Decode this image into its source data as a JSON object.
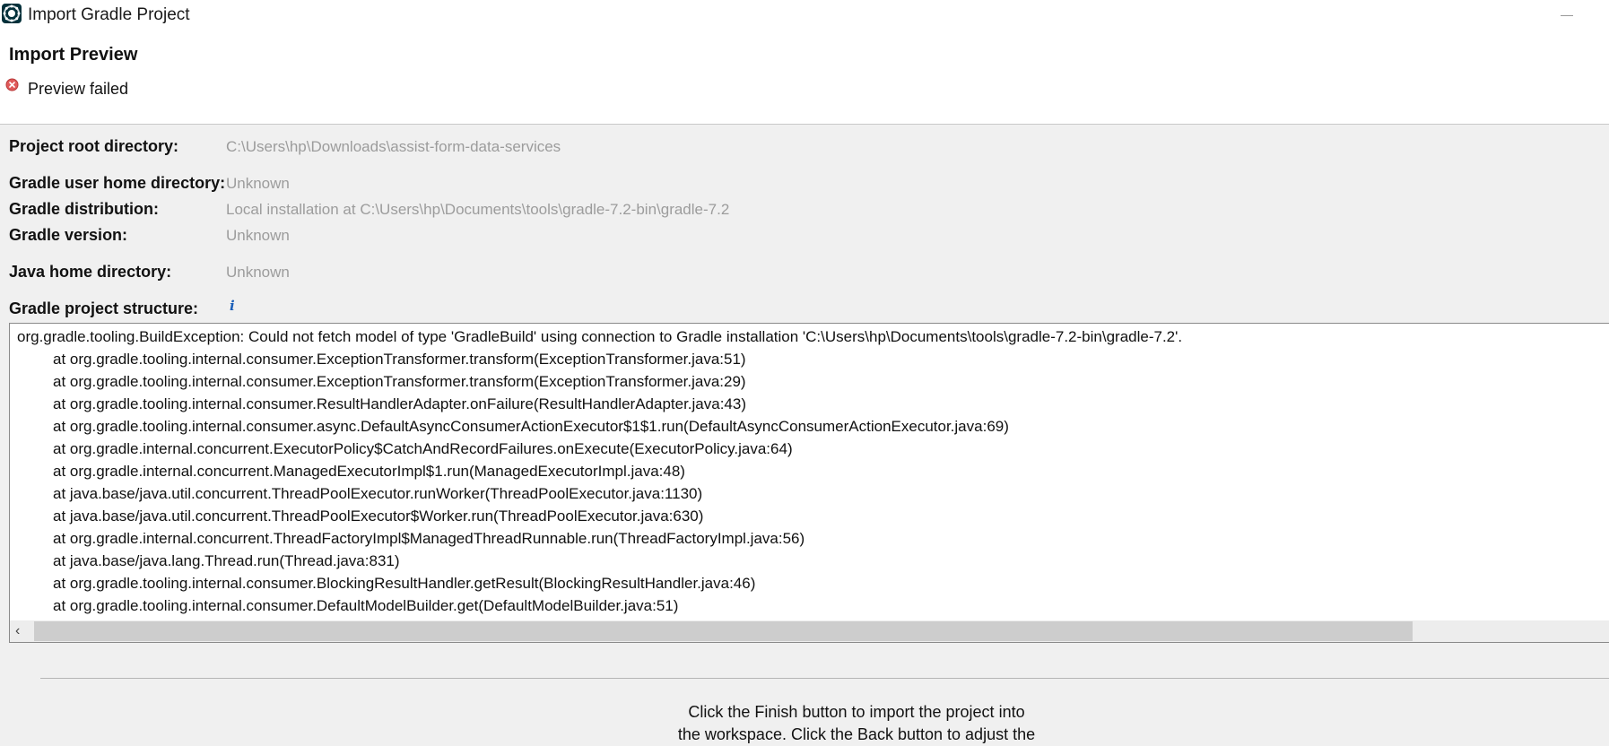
{
  "window": {
    "title": "Import Gradle Project",
    "icon": "gradle-eclipse-icon"
  },
  "header": {
    "title": "Import Preview",
    "status_icon": "error-icon",
    "status": "Preview failed"
  },
  "properties": [
    {
      "label": "Project root directory:",
      "value": "C:\\Users\\hp\\Downloads\\assist-form-data-services"
    },
    {
      "label": "Gradle user home directory:",
      "value": "Unknown"
    },
    {
      "label": "Gradle distribution:",
      "value": "Local installation at C:\\Users\\hp\\Documents\\tools\\gradle-7.2-bin\\gradle-7.2"
    },
    {
      "label": "Gradle version:",
      "value": "Unknown"
    },
    {
      "label": "Java home directory:",
      "value": "Unknown"
    },
    {
      "label": "Gradle project structure:",
      "value": ""
    }
  ],
  "structure_info_icon": "info-icon",
  "trace": [
    "org.gradle.tooling.BuildException: Could not fetch model of type 'GradleBuild' using connection to Gradle installation 'C:\\Users\\hp\\Documents\\tools\\gradle-7.2-bin\\gradle-7.2'.",
    "at org.gradle.tooling.internal.consumer.ExceptionTransformer.transform(ExceptionTransformer.java:51)",
    "at org.gradle.tooling.internal.consumer.ExceptionTransformer.transform(ExceptionTransformer.java:29)",
    "at org.gradle.tooling.internal.consumer.ResultHandlerAdapter.onFailure(ResultHandlerAdapter.java:43)",
    "at org.gradle.tooling.internal.consumer.async.DefaultAsyncConsumerActionExecutor$1$1.run(DefaultAsyncConsumerActionExecutor.java:69)",
    "at org.gradle.internal.concurrent.ExecutorPolicy$CatchAndRecordFailures.onExecute(ExecutorPolicy.java:64)",
    "at org.gradle.internal.concurrent.ManagedExecutorImpl$1.run(ManagedExecutorImpl.java:48)",
    "at java.base/java.util.concurrent.ThreadPoolExecutor.runWorker(ThreadPoolExecutor.java:1130)",
    "at java.base/java.util.concurrent.ThreadPoolExecutor$Worker.run(ThreadPoolExecutor.java:630)",
    "at org.gradle.internal.concurrent.ThreadFactoryImpl$ManagedThreadRunnable.run(ThreadFactoryImpl.java:56)",
    "at java.base/java.lang.Thread.run(Thread.java:831)",
    "at org.gradle.tooling.internal.consumer.BlockingResultHandler.getResult(BlockingResultHandler.java:46)",
    "at org.gradle.tooling.internal.consumer.DefaultModelBuilder.get(DefaultModelBuilder.java:51)"
  ],
  "footer": {
    "line1": "Click the Finish button to import the project into",
    "line2": "the workspace. Click the Back button to adjust the"
  }
}
